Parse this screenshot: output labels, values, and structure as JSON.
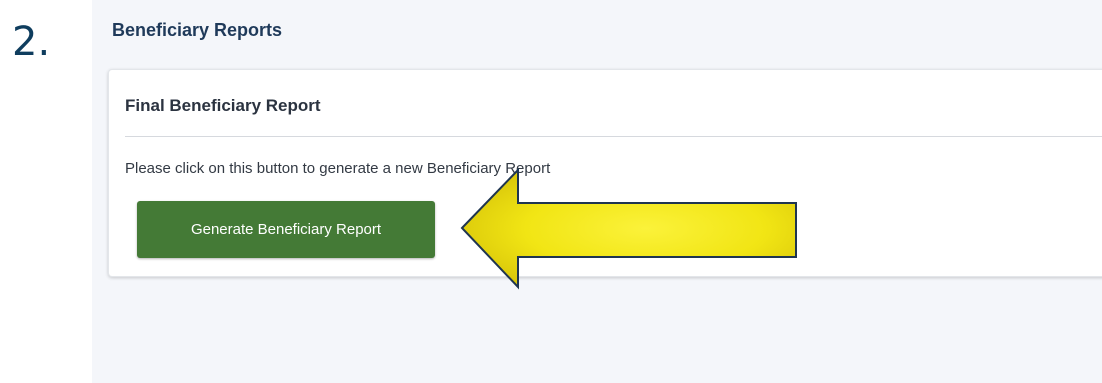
{
  "step": {
    "number": "2."
  },
  "section": {
    "title": "Beneficiary Reports"
  },
  "card": {
    "header": "Final Beneficiary Report",
    "description": "Please click on this button to generate a new Beneficiary Report",
    "button_label": "Generate Beneficiary Report"
  },
  "colors": {
    "step_number": "#0f3d5e",
    "button": "#447a36",
    "arrow_fill": "#f4ea18",
    "arrow_outline": "#1f3550",
    "panel_background": "#f4f6fa"
  },
  "annotation": {
    "icon": "pointer-arrow-icon"
  }
}
